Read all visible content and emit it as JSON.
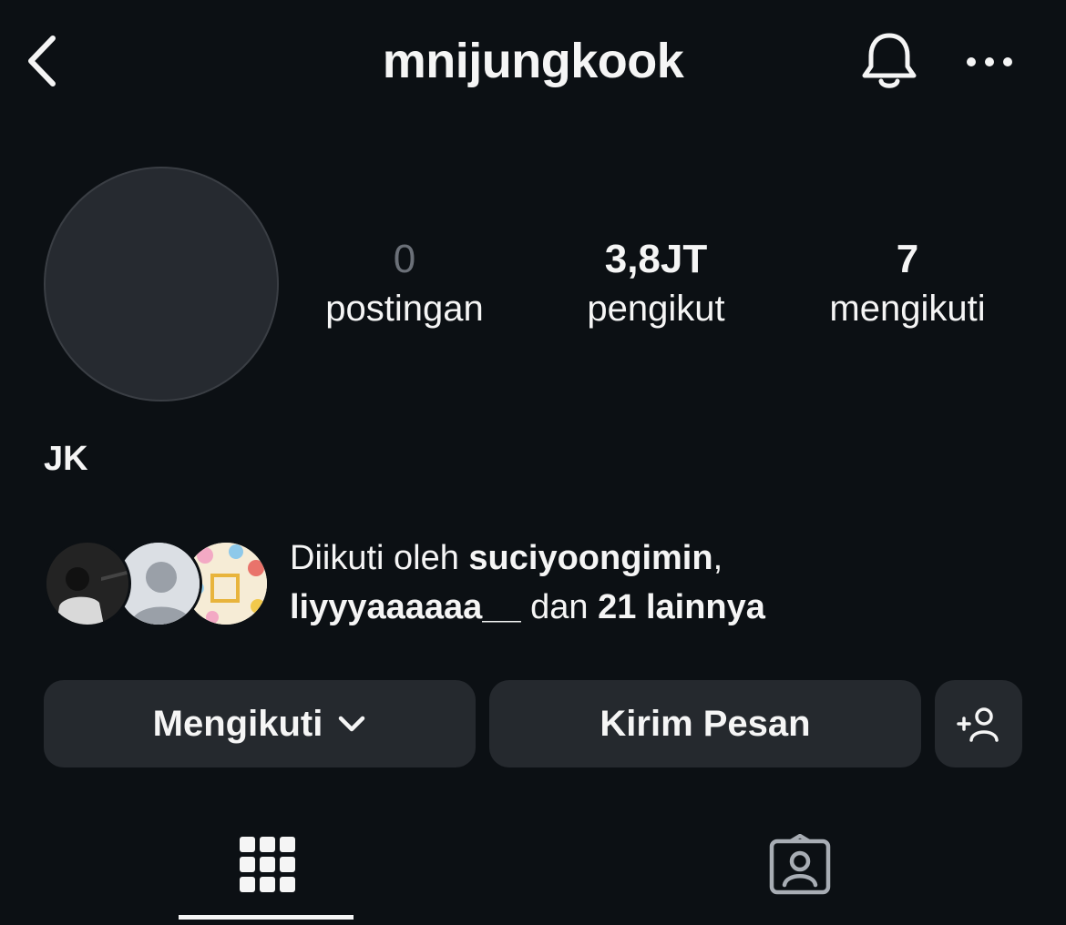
{
  "header": {
    "username": "mnijungkook",
    "back_icon": "chevron-left-icon",
    "bell_icon": "bell-icon",
    "more_icon": "more-horizontal-icon"
  },
  "profile": {
    "display_name": "JK",
    "stats": [
      {
        "value": "0",
        "label": "postingan"
      },
      {
        "value": "3,8JT",
        "label": "pengikut"
      },
      {
        "value": "7",
        "label": "mengikuti"
      }
    ]
  },
  "followed_by": {
    "prefix": "Diikuti oleh ",
    "user1": "suciyoongimin",
    "sep": ",",
    "user2": "liyyyaaaaaa__",
    "mid": " dan ",
    "others": "21 lainnya"
  },
  "actions": {
    "follow_label": "Mengikuti",
    "message_label": "Kirim Pesan",
    "add_icon": "add-person-icon"
  },
  "tabs": {
    "grid_icon": "grid-icon",
    "tagged_icon": "tagged-person-icon",
    "active": "grid"
  },
  "colors": {
    "background": "#0c1014",
    "button": "#25292e",
    "text": "#f5f5f5",
    "muted": "#6b7078"
  }
}
